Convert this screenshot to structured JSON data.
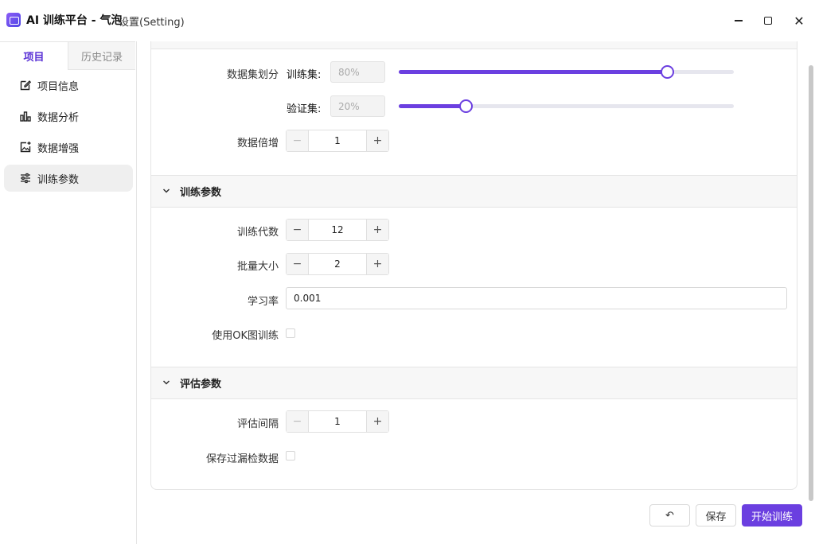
{
  "window": {
    "title": "AI 训练平台 - 气泡",
    "subtitle": "设置(Setting)",
    "close_glyph": "✕"
  },
  "sidebar": {
    "tabs": [
      {
        "label": "项目",
        "active": true
      },
      {
        "label": "历史记录",
        "active": false
      }
    ],
    "items": [
      {
        "label": "项目信息",
        "icon": "edit-icon",
        "active": false
      },
      {
        "label": "数据分析",
        "icon": "bar-chart-icon",
        "active": false
      },
      {
        "label": "数据增强",
        "icon": "image-plus-icon",
        "active": false
      },
      {
        "label": "训练参数",
        "icon": "sliders-icon",
        "active": true
      }
    ]
  },
  "data_section": {
    "split_label": "数据集划分",
    "train_sublabel": "训练集:",
    "train_value": "80%",
    "train_fraction": 0.8,
    "val_sublabel": "验证集:",
    "val_value": "20%",
    "val_fraction": 0.2,
    "multiply_label": "数据倍增",
    "multiply_value": "1"
  },
  "train_section": {
    "title": "训练参数",
    "epochs_label": "训练代数",
    "epochs_value": "12",
    "batch_label": "批量大小",
    "batch_value": "2",
    "lr_label": "学习率",
    "lr_value": "0.001",
    "use_ok_label": "使用OK图训练",
    "use_ok_checked": false
  },
  "eval_section": {
    "title": "评估参数",
    "interval_label": "评估间隔",
    "interval_value": "1",
    "save_missed_label": "保存过漏检数据",
    "save_missed_checked": false
  },
  "stepper": {
    "minus": "−",
    "plus": "+"
  },
  "footer": {
    "reset_glyph": "↶",
    "save_label": "保存",
    "start_label": "开始训练"
  },
  "colors": {
    "accent": "#6b3fe0"
  }
}
